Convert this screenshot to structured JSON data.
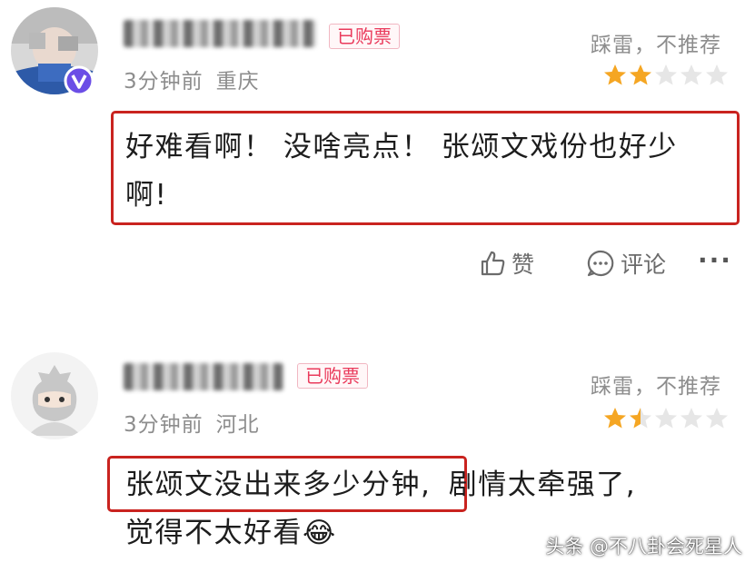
{
  "reviews": [
    {
      "name_hidden": true,
      "badge": "已购票",
      "time": "3分钟前",
      "location": "重庆",
      "verdict": "踩雷，不推荐",
      "rating_stars": 2,
      "comment_line1": "好难看啊！ 没啥亮点！ 张颂文戏份也好少",
      "comment_line2": "啊!",
      "actions": {
        "like": "赞",
        "comment": "评论",
        "more": "···"
      },
      "accent": "#c9231f"
    },
    {
      "name_hidden": true,
      "badge": "已购票",
      "time": "3分钟前",
      "location": "河北",
      "verdict": "踩雷，不推荐",
      "rating_stars": 1.5,
      "comment_boxed": "张颂文没出来多少分钟,",
      "comment_rest": "剧情太牵强了,",
      "comment_line2": "觉得不太好看",
      "emoji": "😂"
    }
  ],
  "icons": [
    "vip-v-icon",
    "star-icon",
    "thumbs-up-icon",
    "comment-bubble-icon",
    "more-icon",
    "laughing-emoji-icon"
  ],
  "colors": {
    "badge_text": "#ea3a5b",
    "star_filled": "#f5a623",
    "star_empty": "#e3e3e3",
    "highlight_box": "#c9231f"
  },
  "watermark": "头条 @不八卦会死星人"
}
